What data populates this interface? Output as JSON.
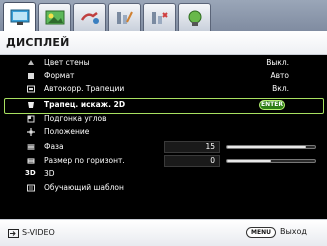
{
  "title": "ДИСПЛЕЙ",
  "tabs": [
    {
      "icon": "display-tab-icon",
      "active": true
    },
    {
      "icon": "picture-tab-icon",
      "active": false
    },
    {
      "icon": "source-tab-icon",
      "active": false
    },
    {
      "icon": "system-setup-basic-tab-icon",
      "active": false
    },
    {
      "icon": "system-setup-advanced-tab-icon",
      "active": false
    },
    {
      "icon": "information-tab-icon",
      "active": false
    }
  ],
  "menu": {
    "items": [
      {
        "label": "Цвет стены",
        "value": "Выкл.",
        "icon": "wall-color-icon"
      },
      {
        "label": "Формат",
        "value": "Авто",
        "icon": "aspect-ratio-icon"
      },
      {
        "label": "Автокорр. Трапеции",
        "value": "Вкл.",
        "icon": "auto-keystone-icon"
      },
      {
        "label": "Трапец. искаж. 2D",
        "value": "ENTER",
        "icon": "keystone-2d-icon"
      },
      {
        "label": "Подгонка углов",
        "value": "",
        "icon": "corner-fit-icon"
      },
      {
        "label": "Положение",
        "value": "",
        "icon": "position-icon"
      },
      {
        "label": "Фаза",
        "value": "15",
        "icon": "phase-icon",
        "slider": 0.9
      },
      {
        "label": "Размер по горизонт.",
        "value": "0",
        "icon": "h-size-icon",
        "slider": 0.5
      },
      {
        "label": "3D",
        "value": "",
        "icon": "3d-icon"
      },
      {
        "label": "Обучающий шаблон",
        "value": "",
        "icon": "test-pattern-icon"
      }
    ],
    "selected_index": 3
  },
  "status": {
    "source": "S-VIDEO",
    "menu_key": "MENU",
    "exit_label": "Выход"
  },
  "colors": {
    "panel_bg": "#000000",
    "highlight_border": "#a8e060",
    "enter_pill": "#2e7d16"
  }
}
